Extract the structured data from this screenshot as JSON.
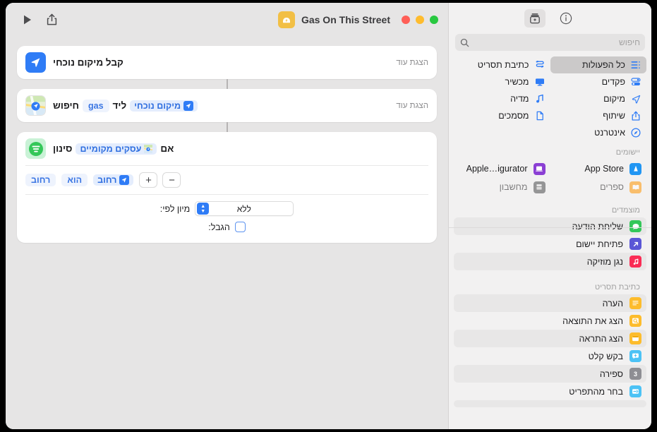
{
  "window": {
    "title": "Gas On This Street",
    "traffic": {
      "close": "#ff5f57",
      "minimize": "#febc2e",
      "zoom": "#28c840"
    }
  },
  "sidebar": {
    "toolbar": {
      "info_label": "i",
      "add_label": "+"
    },
    "search": {
      "placeholder": "חיפוש",
      "value": ""
    },
    "categories": [
      {
        "label": "כל הפעולות",
        "icon": "list-icon",
        "selected": true
      },
      {
        "label": "כתיבת תסריט",
        "icon": "script-icon",
        "selected": false
      },
      {
        "label": "פקדים",
        "icon": "controls-icon",
        "selected": false
      },
      {
        "label": "מכשיר",
        "icon": "device-icon",
        "selected": false
      },
      {
        "label": "מיקום",
        "icon": "location-icon",
        "selected": false
      },
      {
        "label": "מדיה",
        "icon": "media-icon",
        "selected": false
      },
      {
        "label": "שיתוף",
        "icon": "share-icon",
        "selected": false
      },
      {
        "label": "מסמכים",
        "icon": "documents-icon",
        "selected": false
      },
      {
        "label": "אינטרנט",
        "icon": "internet-icon",
        "selected": false
      }
    ],
    "apps_header": "יישומים",
    "apps": [
      {
        "label": "App Store",
        "color": "#1e8fff",
        "glyph": "A"
      },
      {
        "label": "Apple…igurator",
        "color": "#8b3fd4",
        "glyph": "▤"
      },
      {
        "label": "ספרים",
        "color": "#ff9500",
        "glyph": "▥"
      },
      {
        "label": "מחשבון",
        "color": "#4a4a4c",
        "glyph": "▦"
      }
    ],
    "suggestions_header": "מוצמדים",
    "suggestions": [
      {
        "label": "שליחת הודעה",
        "color": "#34c759",
        "glyph": "💬"
      },
      {
        "label": "פתיחת יישום",
        "color": "#5a56d6",
        "glyph": "↗"
      },
      {
        "label": "נגן מוזיקה",
        "color": "#fa2c55",
        "glyph": "♪"
      }
    ],
    "scripting_header": "כתיבת תסריט",
    "scripting": [
      {
        "label": "הערה",
        "color": "#fdbc2c",
        "glyph": "≡"
      },
      {
        "label": "הצג את התוצאה",
        "color": "#fdbc2c",
        "glyph": "⌗"
      },
      {
        "label": "הצג התראה",
        "color": "#fdbc2c",
        "glyph": "▭"
      },
      {
        "label": "בקש קלט",
        "color": "#4cc2f5",
        "glyph": "＋"
      },
      {
        "label": "ספירה",
        "color": "#8e8e93",
        "glyph": "3"
      },
      {
        "label": "בחר מהתפריט",
        "color": "#4cc2f5",
        "glyph": "▤"
      }
    ]
  },
  "main": {
    "toolbar": {
      "run_label": "▶",
      "share_label": "share-icon"
    },
    "cards": [
      {
        "icon_color": "#2f7cf6",
        "icon_glyph": "navigation-arrow-icon",
        "title": "קבל מיקום נוכחי",
        "show_more": "הצגת עוד"
      },
      {
        "icon_color": "#ffffff",
        "icon_glyph": "maps-icon",
        "title_prefix": "חיפוש",
        "query_token": "gas",
        "near_word": "ליד",
        "location_token": "מיקום נוכחי",
        "show_more": "הצגת עוד"
      },
      {
        "icon_color": "#c8f0d4",
        "icon_glyph": "filter-icon",
        "title_prefix": "סינון",
        "source_token": "עסקים מקומיים",
        "title_suffix": "אם",
        "filter_tokens": [
          "רחוב",
          "הוא",
          "רחוב"
        ],
        "plus_label": "+",
        "minus_label": "−",
        "sort_label": "מיון לפי:",
        "sort_value": "ללא",
        "limit_label": "הגבל:",
        "limit_checked": false
      }
    ]
  }
}
